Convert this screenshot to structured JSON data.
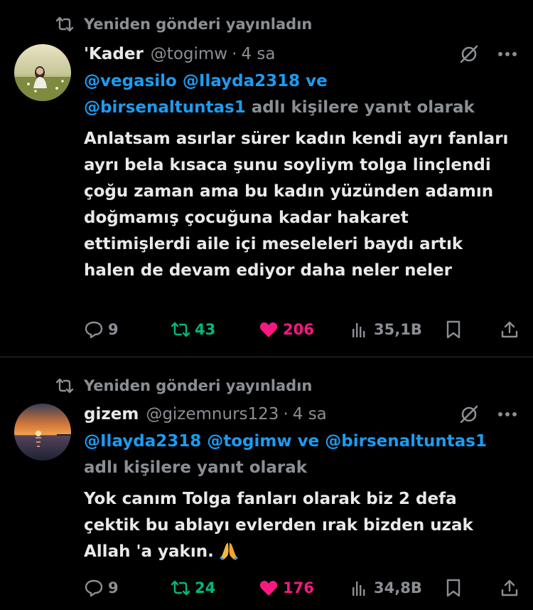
{
  "tweets": [
    {
      "repost_label": "Yeniden gönderi yayınladın",
      "name": "'Kader",
      "handle": "@togimw",
      "dot": "·",
      "time": "4 sa",
      "reply_mentions": [
        "@vegasilo",
        "@Ilayda2318"
      ],
      "reply_and": "ve",
      "reply_last_mention": "@birsenaltuntas1",
      "reply_suffix": "adlı kişilere yanıt olarak",
      "text": "Anlatsam asırlar sürer kadın kendi ayrı fanları ayrı bela kısaca şunu soyliym tolga linçlendi çoğu zaman ama bu kadın yüzünden adamın doğmamış çocuğuna kadar hakaret ettimişlerdi aile içi meseleleri baydı artık halen de devam ediyor daha neler neler",
      "replies": "9",
      "retweets": "43",
      "likes": "206",
      "views": "35,1B"
    },
    {
      "repost_label": "Yeniden gönderi yayınladın",
      "name": "gizem",
      "handle": "@gizemnurs123",
      "dot": "·",
      "time": "4 sa",
      "reply_mentions": [
        "@Ilayda2318",
        "@togimw"
      ],
      "reply_and": "ve",
      "reply_last_mention": "@birsenaltuntas1",
      "reply_suffix": "adlı kişilere yanıt olarak",
      "text": "Yok canım Tolga fanları olarak biz 2 defa çektik bu ablayı evlerden ırak bizden uzak Allah 'a yakın.",
      "emoji": "folded-hands",
      "replies": "9",
      "retweets": "24",
      "likes": "176",
      "views": "34,8B"
    }
  ],
  "colors": {
    "background": "#000000",
    "text": "#e7e9ea",
    "muted": "#8b8f94",
    "mention": "#1d9bf0",
    "retweet": "#00ba7c",
    "like": "#f91880"
  }
}
